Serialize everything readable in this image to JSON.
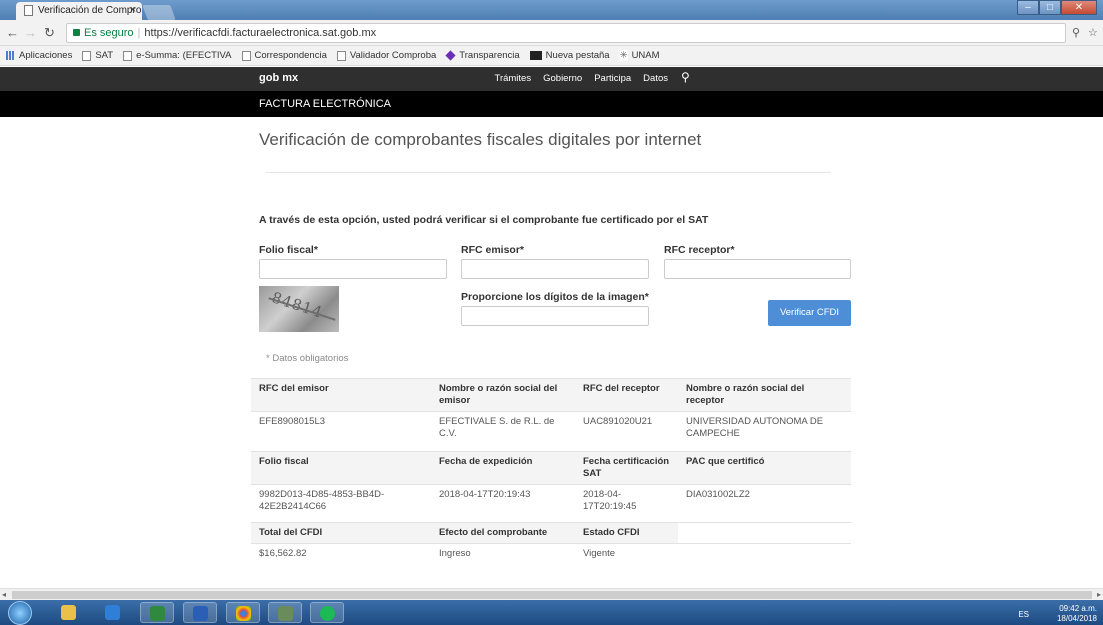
{
  "browser": {
    "tab_title": "Verificación de Comprob",
    "tab_close": "×",
    "url_secure_label": "Es seguro",
    "url": "https://verificacfdi.facturaelectronica.sat.gob.mx",
    "bookmarks": [
      "Aplicaciones",
      "SAT",
      "e-Summa: (EFECTIVA",
      "Correspondencia",
      "Validador Comproba",
      "Transparencia",
      "Nueva pestaña",
      "UNAM"
    ]
  },
  "site": {
    "logo": "gob mx",
    "nav": [
      "Trámites",
      "Gobierno",
      "Participa",
      "Datos"
    ],
    "section": "FACTURA ELECTRÓNICA"
  },
  "page": {
    "title": "Verificación de comprobantes fiscales digitales por internet",
    "intro": "A través de esta opción, usted podrá verificar si el comprobante fue certificado por el SAT",
    "folio_label": "Folio fiscal*",
    "rfc_emisor_label": "RFC emisor*",
    "rfc_receptor_label": "RFC receptor*",
    "captcha_label": "Proporcione los dígitos de la imagen*",
    "captcha_text": "84814",
    "verify_button": "Verificar CFDI",
    "required_note": "* Datos obligatorios"
  },
  "results": {
    "row1_headers": [
      "RFC del emisor",
      "Nombre o razón social del emisor",
      "RFC del receptor",
      "Nombre o razón social del receptor"
    ],
    "row1_values": [
      "EFE8908015L3",
      "EFECTIVALE S. de R.L. de C.V.",
      "UAC891020U21",
      "UNIVERSIDAD AUTONOMA DE CAMPECHE"
    ],
    "row2_headers": [
      "Folio fiscal",
      "Fecha de expedición",
      "Fecha certificación SAT",
      "PAC que certificó"
    ],
    "row2_values": [
      "9982D013-4D85-4853-BB4D-42E2B2414C66",
      "2018-04-17T20:19:43",
      "2018-04-17T20:19:45",
      "DIA031002LZ2"
    ],
    "row3_headers": [
      "Total del CFDI",
      "Efecto del comprobante",
      "Estado CFDI"
    ],
    "row3_values": [
      "$16,562.82",
      "Ingreso",
      "Vigente"
    ]
  },
  "taskbar": {
    "lang": "ES",
    "time": "09:42 a.m.",
    "date": "18/04/2018"
  }
}
